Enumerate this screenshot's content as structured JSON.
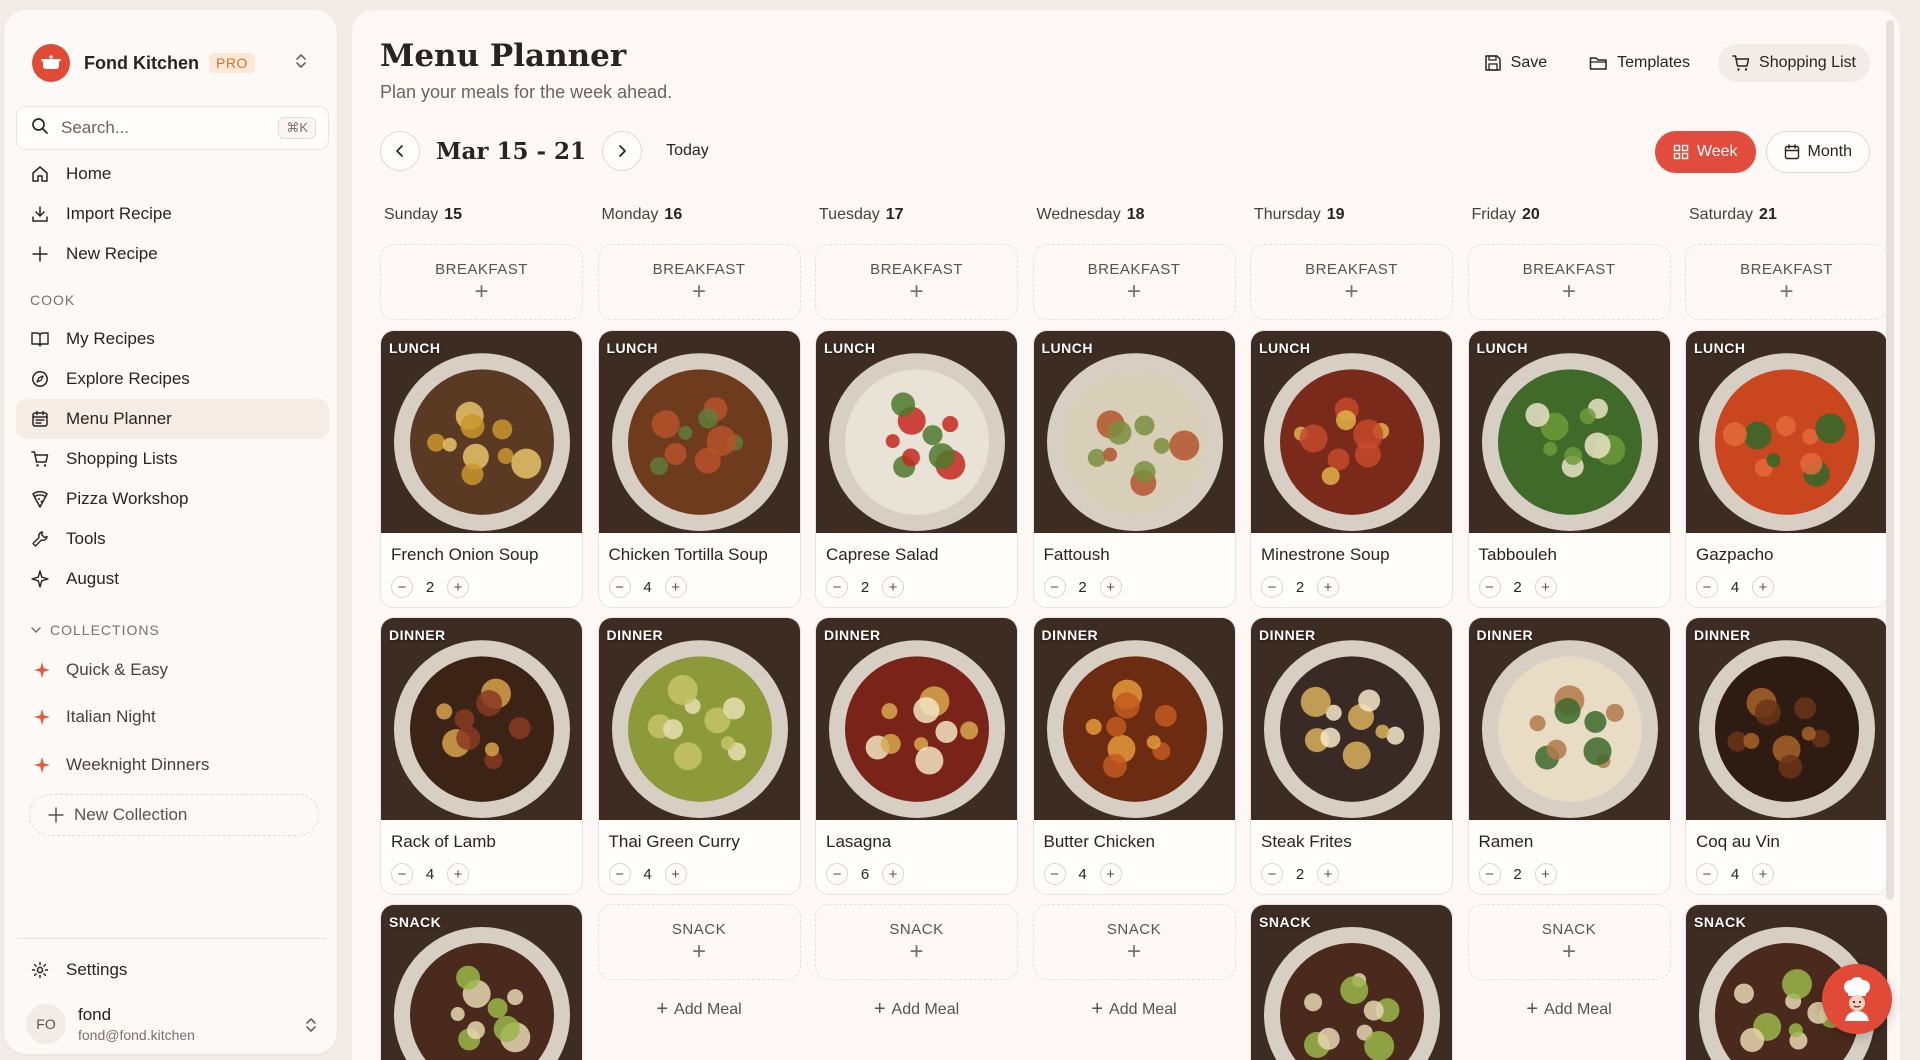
{
  "app": {
    "name": "Fond Kitchen",
    "plan": "PRO"
  },
  "search": {
    "placeholder": "Search...",
    "shortcut": "⌘K"
  },
  "nav": {
    "home": "Home",
    "import": "Import Recipe",
    "new_recipe": "New Recipe",
    "cook_section": "COOK",
    "my_recipes": "My Recipes",
    "explore": "Explore Recipes",
    "menu_planner": "Menu Planner",
    "shopping_lists": "Shopping Lists",
    "pizza": "Pizza Workshop",
    "tools": "Tools",
    "august": "August"
  },
  "collections": {
    "label": "COLLECTIONS",
    "items": [
      "Quick & Easy",
      "Italian Night",
      "Weeknight Dinners"
    ],
    "new_label": "New Collection"
  },
  "settings_label": "Settings",
  "user": {
    "initials": "FO",
    "name": "fond",
    "email": "fond@fond.kitchen"
  },
  "page": {
    "title": "Menu Planner",
    "subtitle": "Plan your meals for the week ahead."
  },
  "actions": {
    "save": "Save",
    "templates": "Templates",
    "shopping_list": "Shopping List"
  },
  "week": {
    "range": "Mar 15 - 21",
    "today": "Today"
  },
  "views": {
    "week": "Week",
    "month": "Month",
    "active": "week"
  },
  "colors": {
    "accent": "#e24c3c",
    "brand": "#e04a36"
  },
  "slot_labels": {
    "breakfast": "BREAKFAST",
    "lunch": "LUNCH",
    "dinner": "DINNER",
    "snack": "SNACK"
  },
  "add_meal_label": "Add Meal",
  "days": [
    {
      "name": "Sunday",
      "date": "15",
      "lunch": {
        "name": "French Onion Soup",
        "servings": "2"
      },
      "dinner": {
        "name": "Rack of Lamb",
        "servings": "4"
      },
      "snack": {
        "present": true
      }
    },
    {
      "name": "Monday",
      "date": "16",
      "lunch": {
        "name": "Chicken Tortilla Soup",
        "servings": "4"
      },
      "dinner": {
        "name": "Thai Green Curry",
        "servings": "4"
      },
      "snack": {
        "present": false
      }
    },
    {
      "name": "Tuesday",
      "date": "17",
      "lunch": {
        "name": "Caprese Salad",
        "servings": "2"
      },
      "dinner": {
        "name": "Lasagna",
        "servings": "6"
      },
      "snack": {
        "present": false
      }
    },
    {
      "name": "Wednesday",
      "date": "18",
      "lunch": {
        "name": "Fattoush",
        "servings": "2"
      },
      "dinner": {
        "name": "Butter Chicken",
        "servings": "4"
      },
      "snack": {
        "present": false
      }
    },
    {
      "name": "Thursday",
      "date": "19",
      "lunch": {
        "name": "Minestrone Soup",
        "servings": "2"
      },
      "dinner": {
        "name": "Steak Frites",
        "servings": "2"
      },
      "snack": {
        "present": true
      }
    },
    {
      "name": "Friday",
      "date": "20",
      "lunch": {
        "name": "Tabbouleh",
        "servings": "2"
      },
      "dinner": {
        "name": "Ramen",
        "servings": "2"
      },
      "snack": {
        "present": false
      }
    },
    {
      "name": "Saturday",
      "date": "21",
      "lunch": {
        "name": "Gazpacho",
        "servings": "4"
      },
      "dinner": {
        "name": "Coq au Vin",
        "servings": "4"
      },
      "snack": {
        "present": true
      }
    }
  ]
}
